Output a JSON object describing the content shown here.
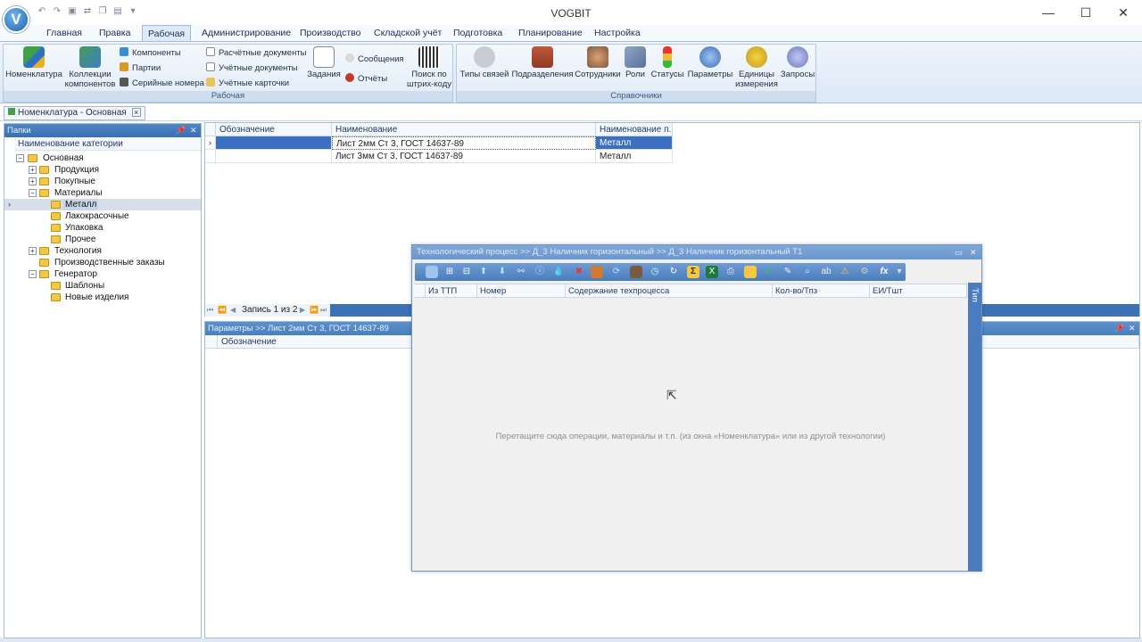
{
  "window": {
    "title": "VOGBIT",
    "minimize": "—",
    "maximize": "☐",
    "close": "✕",
    "logo": "V"
  },
  "menu": {
    "tabs": [
      {
        "label": "Главная"
      },
      {
        "label": "Правка"
      },
      {
        "label": "Рабочая"
      },
      {
        "label": "Администрирование"
      },
      {
        "label": "Производство"
      },
      {
        "label": "Складской учёт"
      },
      {
        "label": "Подготовка"
      },
      {
        "label": "Планирование"
      },
      {
        "label": "Настройка"
      }
    ],
    "active_tab": "Рабочая"
  },
  "ribbon": {
    "group_work": {
      "label": "Рабочая",
      "nomenclature": "Номенклатура",
      "collections_1": "Коллекции",
      "collections_2": "компонентов",
      "components": "Компоненты",
      "batches": "Партии",
      "serials": "Серийные номера",
      "calc_docs": "Расчётные документы",
      "acc_docs": "Учётные документы",
      "acc_cards": "Учётные карточки",
      "tasks": "Задания",
      "messages": "Сообщения",
      "reports": "Отчёты",
      "barcode_1": "Поиск по",
      "barcode_2": "штрих-коду"
    },
    "group_ref": {
      "label": "Справочники",
      "link_types": "Типы связей",
      "departments": "Подразделения",
      "employees": "Сотрудники",
      "roles": "Роли",
      "statuses": "Статусы",
      "parameters": "Параметры",
      "units_1": "Единицы",
      "units_2": "измерения",
      "queries": "Запросы"
    }
  },
  "doc_tab": {
    "label": "Номенклатура - Основная",
    "close": "×"
  },
  "folders": {
    "title": "Папки",
    "column": "Наименование категории",
    "tree": {
      "root": "Основная",
      "products": "Продукция",
      "purchased": "Покупные",
      "materials": "Материалы",
      "metal": "Металл",
      "paints": "Лакокрасочные",
      "packaging": "Упаковка",
      "other": "Прочее",
      "technology": "Технология",
      "orders": "Производственные заказы",
      "generator": "Генератор",
      "templates": "Шаблоны",
      "new_items": "Новые изделия"
    }
  },
  "grid": {
    "columns": {
      "designation": "Обозначение",
      "name": "Наименование",
      "category": "Наименование п..."
    },
    "rows": [
      {
        "designation": "",
        "name": "Лист 2мм Ст 3, ГОСТ 14637-89",
        "category": "Металл"
      },
      {
        "designation": "",
        "name": "Лист 3мм Ст 3, ГОСТ 14637-89",
        "category": "Металл"
      }
    ],
    "record_info": "Запись 1 из 2"
  },
  "params": {
    "title": "Параметры >> Лист 2мм Ст 3, ГОСТ 14637-89",
    "column": "Обозначение"
  },
  "tech_process": {
    "title": "Технологический процесс >> Д_3 Наличник горизонтальный >> Д_3 Наличник горизонтальный Т1",
    "columns": {
      "from_ttp": "Из ТТП",
      "number": "Номер",
      "content": "Содержание техпроцесса",
      "qty": "Кол-во/Тпз",
      "unit": "ЕИ/Тшт"
    },
    "side_label": "Тип",
    "drop_hint": "Перетащите сюда операции, материалы и т.п. (из окна «Номенклатура» или из другой технологии)",
    "fx_label": "fx",
    "sum_label": "Σ"
  },
  "colors": {
    "accent": "#3a6fc1",
    "panel_header": "#4a7dbf",
    "folder": "#f5c842"
  }
}
